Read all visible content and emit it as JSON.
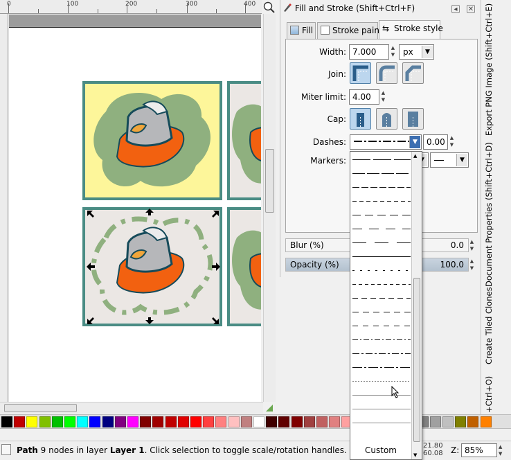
{
  "rulers": {
    "top_labels": [
      "0",
      "100",
      "200",
      "300",
      "400"
    ]
  },
  "dialog": {
    "title": "Fill and Stroke (Shift+Ctrl+F)",
    "tabs": [
      {
        "label": "Fill"
      },
      {
        "label": "Stroke paint"
      },
      {
        "label": "Stroke style"
      }
    ],
    "width": {
      "label": "Width:",
      "value": "7.000",
      "unit": "px"
    },
    "join": {
      "label": "Join:",
      "selected": "miter"
    },
    "miter_limit": {
      "label": "Miter limit:",
      "value": "4.00"
    },
    "cap": {
      "label": "Cap:",
      "selected": "butt"
    },
    "dashes": {
      "label": "Dashes:",
      "offset": "0.00"
    },
    "markers": {
      "label": "Markers:"
    },
    "blur": {
      "label": "Blur (%)",
      "value": "0.0"
    },
    "opacity": {
      "label": "Opacity (%)",
      "value": "100.0"
    }
  },
  "dash_dropdown": {
    "custom_label": "Custom",
    "patterns": [
      "solid-long",
      "solid",
      "dash-dense",
      "dash-small",
      "dash-medium",
      "dash-wide",
      "dash-long",
      "dash-xlong",
      "dot-sparse",
      "dash-tiny",
      "dash-tiny-2",
      "dash-short",
      "dash-short-2",
      "dash-dot",
      "dash-dot-dot",
      "dash-dot-long",
      "dot-fine",
      "solid-thin",
      "solid-thin-2",
      "solid-thin-3"
    ]
  },
  "vertical_tabs": [
    {
      "label": "Export PNG Image (Shift+Ctrl+E)"
    },
    {
      "label": "Document Properties (Shift+Ctrl+D)"
    },
    {
      "label": "Create Tiled Clones"
    },
    {
      "label": "+Ctrl+O)"
    }
  ],
  "palette": {
    "colors": [
      "#000000",
      "#c00000",
      "#ffff00",
      "#80c000",
      "#00c000",
      "#00ff00",
      "#00ffff",
      "#0000ff",
      "#000080",
      "#800080",
      "#ff00ff",
      "#800000",
      "#a00000",
      "#c00000",
      "#e00000",
      "#ff0000",
      "#ff4040",
      "#ff8080",
      "#ffc0c0",
      "#c08080",
      "#ffffff",
      "#400000",
      "#600000",
      "#800000",
      "#a04040",
      "#c06060",
      "#e08080",
      "#ffa0a0",
      "#ffd0d0",
      "#804040",
      "#202020",
      "#404040",
      "#606060",
      "#808080",
      "#a0a0a0",
      "#c0c0c0",
      "#808000",
      "#c06000",
      "#ff8000"
    ]
  },
  "status": {
    "object_type": "Path",
    "message_part1": " 9 nodes in layer ",
    "layer": "Layer 1",
    "message_part2": ". Click selection to toggle scale/rotation handles.",
    "coord_x": "21.80",
    "coord_y": "60.08",
    "zoom_label": "Z:",
    "zoom_value": "85%"
  }
}
